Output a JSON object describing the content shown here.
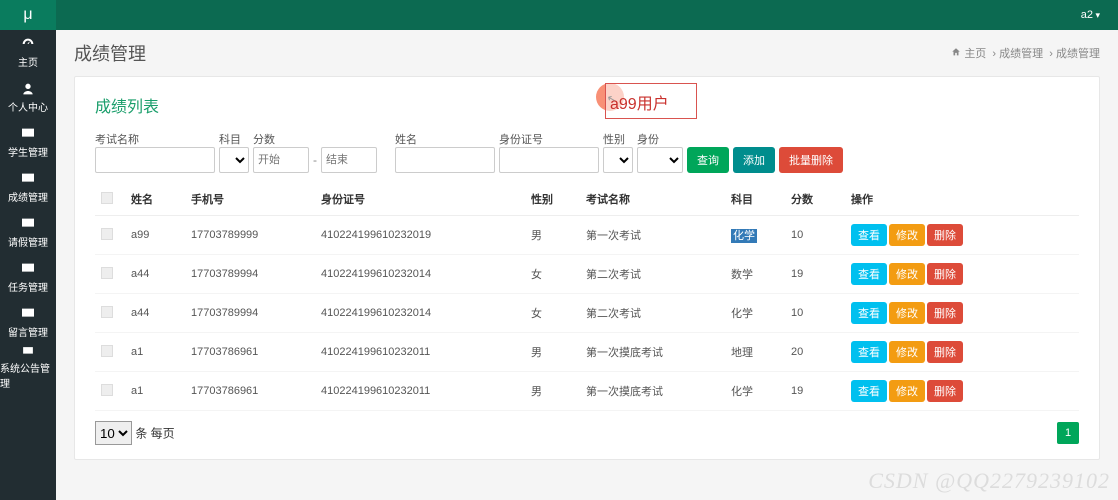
{
  "app": {
    "logo": "μ",
    "user": "a2"
  },
  "sidebar": {
    "items": [
      {
        "label": "主页",
        "icon": "dash"
      },
      {
        "label": "个人中心",
        "icon": "user"
      },
      {
        "label": "学生管理",
        "icon": "mon"
      },
      {
        "label": "成绩管理",
        "icon": "mon"
      },
      {
        "label": "请假管理",
        "icon": "mon"
      },
      {
        "label": "任务管理",
        "icon": "mon"
      },
      {
        "label": "留言管理",
        "icon": "mon"
      },
      {
        "label": "系统公告管理",
        "icon": "mon"
      }
    ]
  },
  "page": {
    "title": "成绩管理",
    "breadcrumb_home": "主页",
    "breadcrumb_mid": "成绩管理",
    "breadcrumb_last": "成绩管理"
  },
  "panel": {
    "title": "成绩列表"
  },
  "filters": {
    "examName": {
      "label": "考试名称",
      "value": ""
    },
    "subject": {
      "label": "科目",
      "value": ""
    },
    "score": {
      "label": "分数",
      "start_ph": "开始",
      "end_ph": "结束",
      "dash": "-"
    },
    "name": {
      "label": "姓名",
      "value": ""
    },
    "idcard": {
      "label": "身份证号",
      "value": ""
    },
    "gender": {
      "label": "性别",
      "value": ""
    },
    "role": {
      "label": "身份",
      "value": ""
    }
  },
  "buttons": {
    "query": "查询",
    "add": "添加",
    "batchDel": "批量删除"
  },
  "table": {
    "headers": {
      "name": "姓名",
      "phone": "手机号",
      "id": "身份证号",
      "gender": "性别",
      "exam": "考试名称",
      "subject": "科目",
      "score": "分数",
      "ops": "操作"
    },
    "rows": [
      {
        "name": "a99",
        "phone": "17703789999",
        "id": "410224199610232019",
        "gender": "男",
        "exam": "第一次考试",
        "subject": "化学",
        "subject_hl": true,
        "score": "10"
      },
      {
        "name": "a44",
        "phone": "17703789994",
        "id": "410224199610232014",
        "gender": "女",
        "exam": "第二次考试",
        "subject": "数学",
        "score": "19"
      },
      {
        "name": "a44",
        "phone": "17703789994",
        "id": "410224199610232014",
        "gender": "女",
        "exam": "第二次考试",
        "subject": "化学",
        "score": "10"
      },
      {
        "name": "a1",
        "phone": "17703786961",
        "id": "410224199610232011",
        "gender": "男",
        "exam": "第一次摸底考试",
        "subject": "地理",
        "score": "20"
      },
      {
        "name": "a1",
        "phone": "17703786961",
        "id": "410224199610232011",
        "gender": "男",
        "exam": "第一次摸底考试",
        "subject": "化学",
        "score": "19"
      }
    ],
    "ops": {
      "view": "查看",
      "edit": "修改",
      "del": "删除"
    },
    "pageSize": "10",
    "perPage": "条 每页",
    "currentPage": "1"
  },
  "callout": "a99用户",
  "watermark": "CSDN @QQ2279239102"
}
